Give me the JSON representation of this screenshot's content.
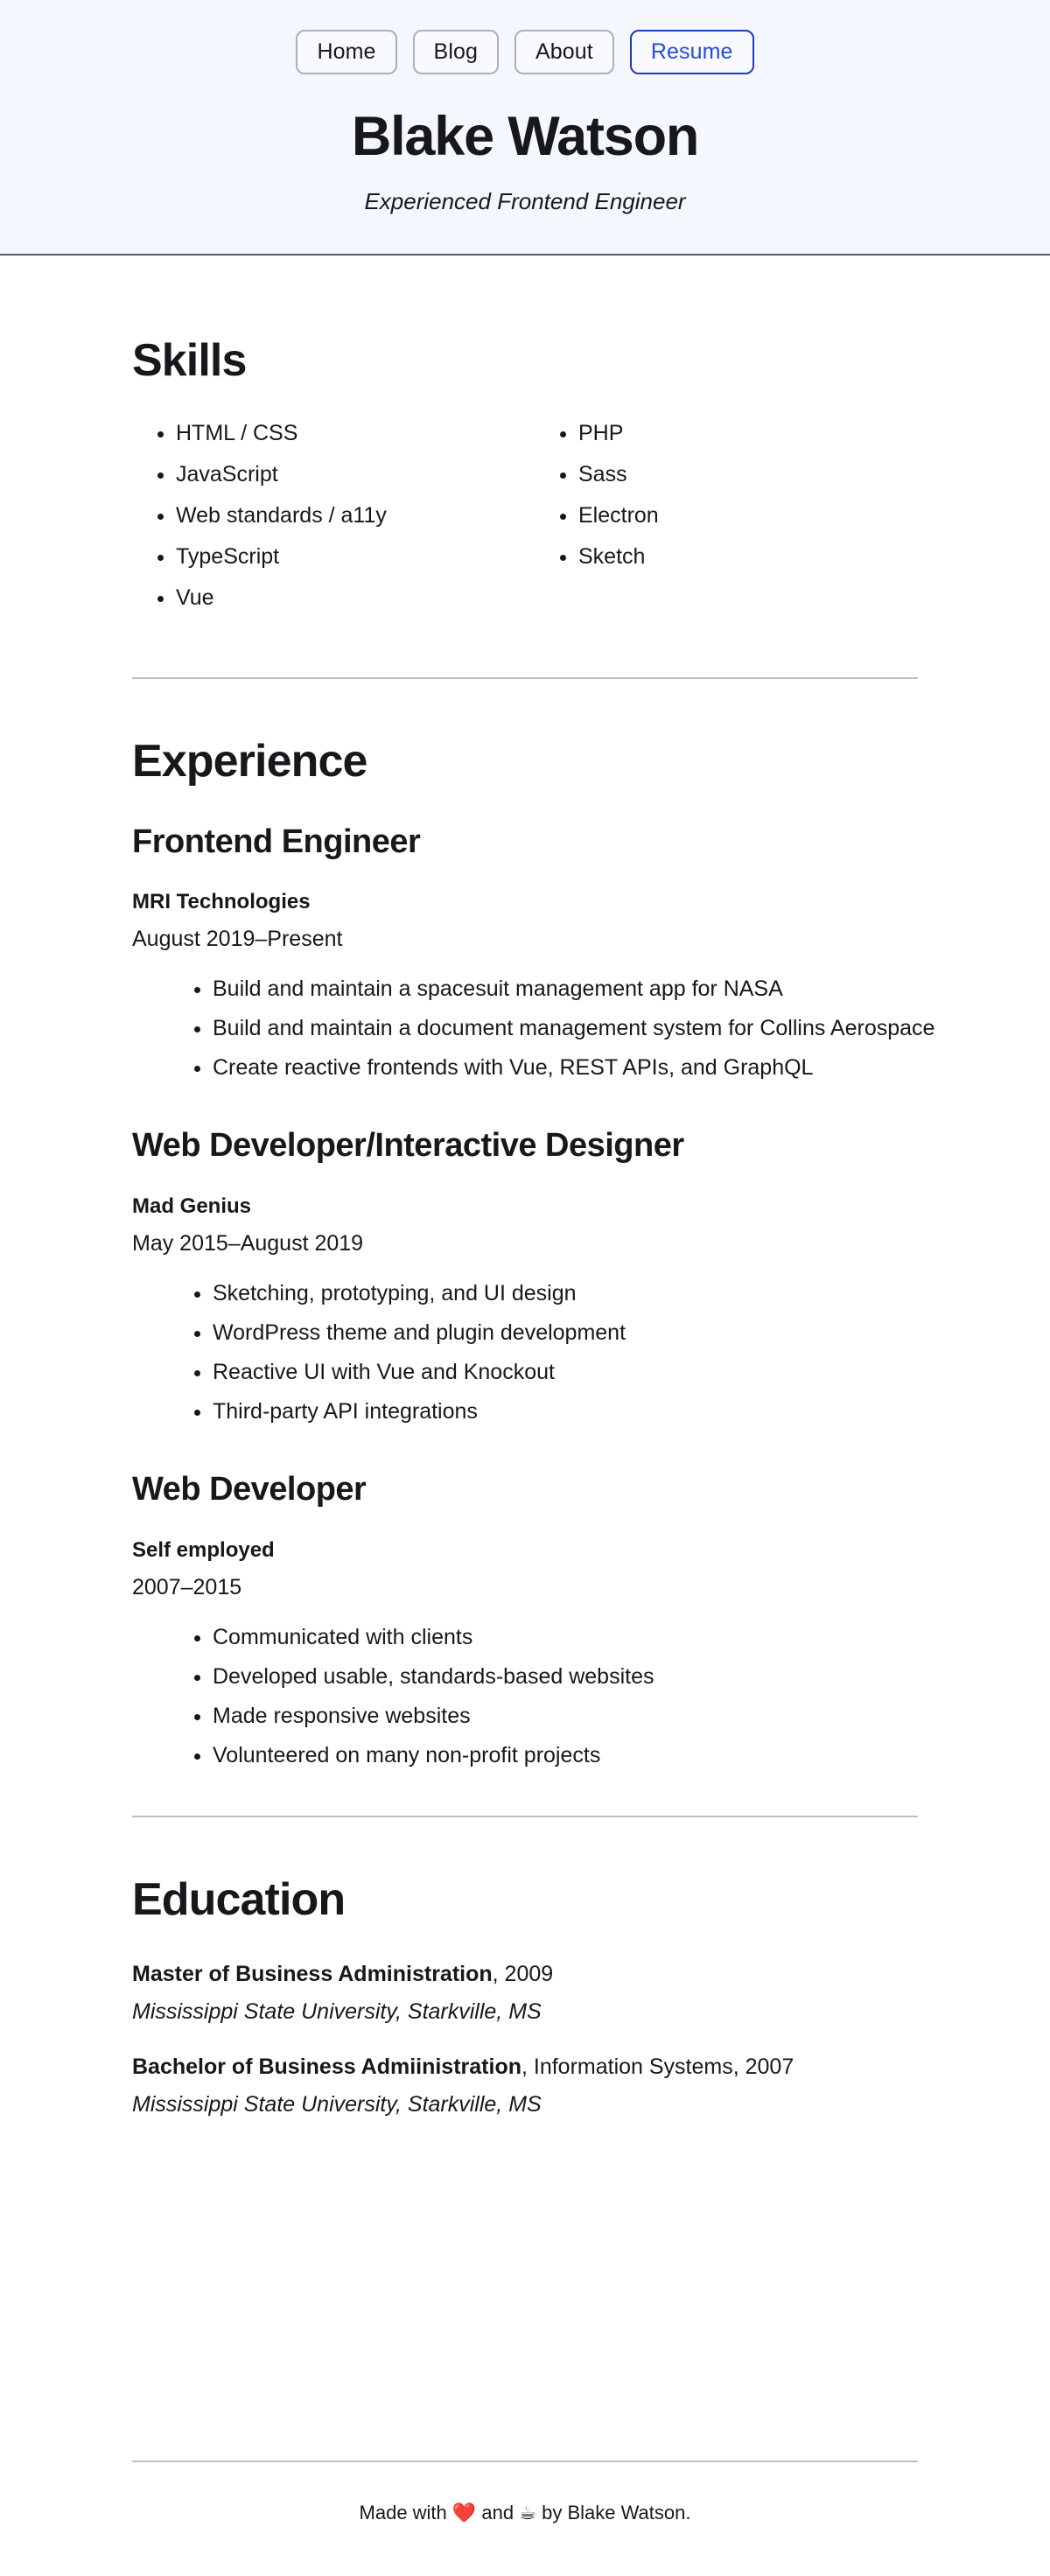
{
  "nav": {
    "items": [
      {
        "label": "Home",
        "active": false
      },
      {
        "label": "Blog",
        "active": false
      },
      {
        "label": "About",
        "active": false
      },
      {
        "label": "Resume",
        "active": true
      }
    ],
    "active_color": "#2b4ad8"
  },
  "header": {
    "title": "Blake Watson",
    "tagline": "Experienced Frontend Engineer",
    "background": "#f4f7fd"
  },
  "skills": {
    "heading": "Skills",
    "column_left": [
      "HTML / CSS",
      "JavaScript",
      "Web standards / a11y",
      "TypeScript",
      "Vue"
    ],
    "column_right": [
      "PHP",
      "Sass",
      "Electron",
      "Sketch"
    ]
  },
  "experience": {
    "heading": "Experience",
    "jobs": [
      {
        "title": "Frontend Engineer",
        "company": "MRI Technologies",
        "dates": "August 2019–Present",
        "bullets": [
          "Build and maintain a spacesuit management app for NASA",
          "Build and maintain a document management system for Collins Aerospace",
          "Create reactive frontends with Vue, REST APIs, and GraphQL"
        ]
      },
      {
        "title": "Web Developer/Interactive Designer",
        "company": "Mad Genius",
        "dates": "May 2015–August 2019",
        "bullets": [
          "Sketching, prototyping, and UI design",
          "WordPress theme and plugin development",
          "Reactive UI with Vue and Knockout",
          "Third-party API integrations"
        ]
      },
      {
        "title": "Web Developer",
        "company": "Self employed",
        "dates": "2007–2015",
        "bullets": [
          "Communicated with clients",
          "Developed usable, standards-based websites",
          "Made responsive websites",
          "Volunteered on many non-profit projects"
        ]
      }
    ]
  },
  "education": {
    "heading": "Education",
    "entries": [
      {
        "degree": "Master of Business Administration",
        "detail": ", 2009",
        "school": "Mississippi State University, Starkville, MS"
      },
      {
        "degree": "Bachelor of Business Admiinistration",
        "detail": ", Information Systems, 2007",
        "school": "Mississippi State University, Starkville, MS"
      }
    ]
  },
  "footer": {
    "prefix": "Made with ",
    "heart": "❤️",
    "middle": " and ",
    "coffee": "☕",
    "suffix": " by Blake Watson."
  }
}
